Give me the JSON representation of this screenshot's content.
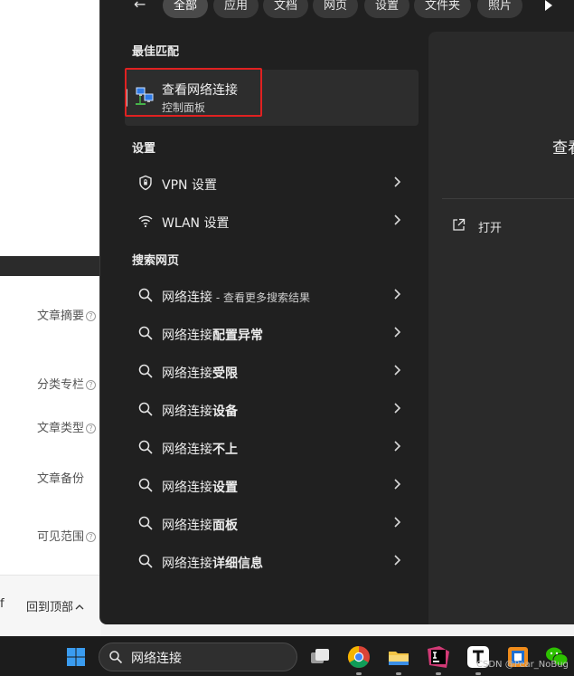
{
  "background_page": {
    "labels": [
      "文章摘要",
      "分类专栏",
      "文章类型",
      "文章备份",
      "可见范围"
    ],
    "help_glyph": "?",
    "back_to_top": "回到顶部",
    "edge_char": "f"
  },
  "search": {
    "back_glyph": "←",
    "filters": [
      "全部",
      "应用",
      "文档",
      "网页",
      "设置",
      "文件夹",
      "照片"
    ],
    "best_match_header": "最佳匹配",
    "best_match": {
      "title": "查看网络连接",
      "subtitle": "控制面板"
    },
    "settings_header": "设置",
    "settings_items": [
      "VPN 设置",
      "WLAN 设置"
    ],
    "web_header": "搜索网页",
    "web_first": {
      "query": "网络连接",
      "suffix": " - 查看更多搜索结果"
    },
    "web_suggestions": [
      {
        "base": "网络连接",
        "extra": "配置异常"
      },
      {
        "base": "网络连接",
        "extra": "受限"
      },
      {
        "base": "网络连接",
        "extra": "设备"
      },
      {
        "base": "网络连接",
        "extra": "不上"
      },
      {
        "base": "网络连接",
        "extra": "设置"
      },
      {
        "base": "网络连接",
        "extra": "面板"
      },
      {
        "base": "网络连接",
        "extra": "详细信息"
      }
    ],
    "preview": {
      "title": "查看",
      "open_label": "打开"
    }
  },
  "taskbar": {
    "search_text": "网络连接",
    "watermark": "CSDN @Pear_NoBug",
    "apps": [
      "task-view-icon",
      "chrome-icon",
      "file-explorer-icon",
      "jetbrains-icon",
      "typora-icon",
      "app-icon",
      "wechat-icon"
    ]
  },
  "colors": {
    "flyout_bg": "#202020",
    "highlight_red": "#e02121",
    "accent_blue": "#2f7ae5"
  }
}
